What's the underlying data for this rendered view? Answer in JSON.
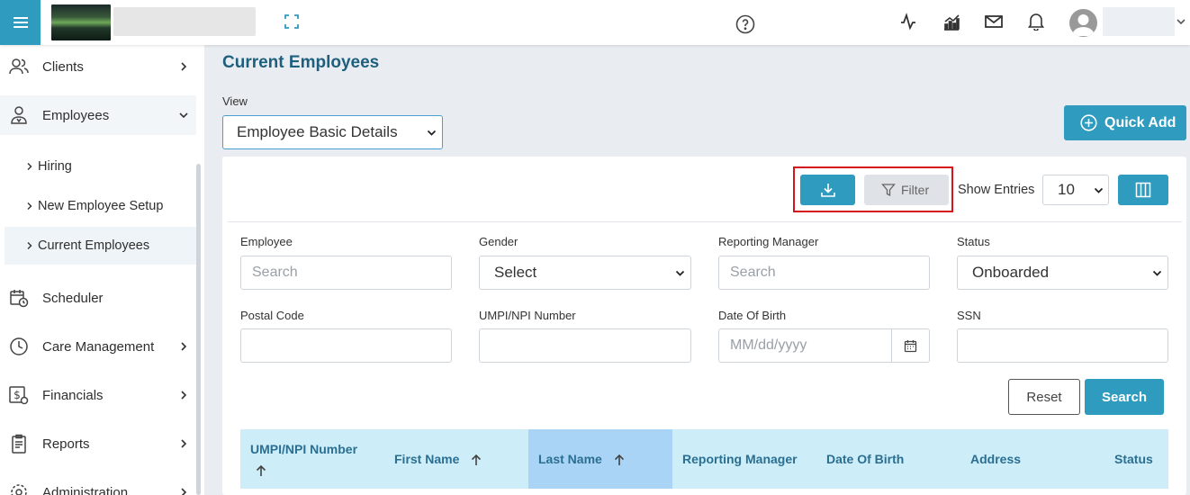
{
  "topbar": {
    "icons": [
      "menu-icon",
      "expand-icon",
      "help-icon",
      "activity-icon",
      "analytics-icon",
      "mail-icon",
      "bell-icon",
      "avatar-icon",
      "chevron-down-icon"
    ]
  },
  "sidebar": {
    "items": [
      {
        "label": "Clients",
        "icon": "people-icon",
        "chevron": "right"
      },
      {
        "label": "Employees",
        "icon": "employee-icon",
        "chevron": "down",
        "expanded": true
      },
      {
        "label": "Scheduler",
        "icon": "calendar-clock-icon",
        "chevron": "none"
      },
      {
        "label": "Care Management",
        "icon": "clock-icon",
        "chevron": "right"
      },
      {
        "label": "Financials",
        "icon": "dollar-icon",
        "chevron": "right"
      },
      {
        "label": "Reports",
        "icon": "clipboard-icon",
        "chevron": "right"
      },
      {
        "label": "Administration",
        "icon": "gear-icon",
        "chevron": "right"
      }
    ],
    "sub_items": [
      {
        "label": "Hiring"
      },
      {
        "label": "New Employee Setup"
      },
      {
        "label": "Current Employees",
        "active": true
      }
    ]
  },
  "main": {
    "title": "Current Employees",
    "view_label": "View",
    "view_value": "Employee Basic Details",
    "quick_add": "Quick Add"
  },
  "toolbar": {
    "filter_label": "Filter",
    "show_entries_label": "Show Entries",
    "entries_value": "10"
  },
  "filters": {
    "employee": {
      "label": "Employee",
      "placeholder": "Search"
    },
    "gender": {
      "label": "Gender",
      "value": "Select"
    },
    "reporting_manager": {
      "label": "Reporting Manager",
      "placeholder": "Search"
    },
    "status": {
      "label": "Status",
      "value": "Onboarded"
    },
    "postal_code": {
      "label": "Postal Code",
      "placeholder": ""
    },
    "umpi": {
      "label": "UMPI/NPI Number",
      "placeholder": ""
    },
    "dob": {
      "label": "Date Of Birth",
      "placeholder": "MM/dd/yyyy"
    },
    "ssn": {
      "label": "SSN",
      "placeholder": ""
    },
    "reset": "Reset",
    "search": "Search"
  },
  "table": {
    "columns": [
      {
        "label": "UMPI/NPI Number",
        "sortable": true
      },
      {
        "label": "First Name",
        "sortable": true
      },
      {
        "label": "Last Name",
        "sortable": true,
        "sorted": true
      },
      {
        "label": "Reporting Manager",
        "sortable": false
      },
      {
        "label": "Date Of Birth",
        "sortable": false
      },
      {
        "label": "Address",
        "sortable": false
      },
      {
        "label": "Status",
        "sortable": false
      }
    ]
  },
  "colors": {
    "accent": "#2f9bbf",
    "title": "#1e5f7e",
    "table_header": "#cdeef8",
    "sorted_column": "#a9d4f6",
    "highlight": "#d4151b"
  }
}
